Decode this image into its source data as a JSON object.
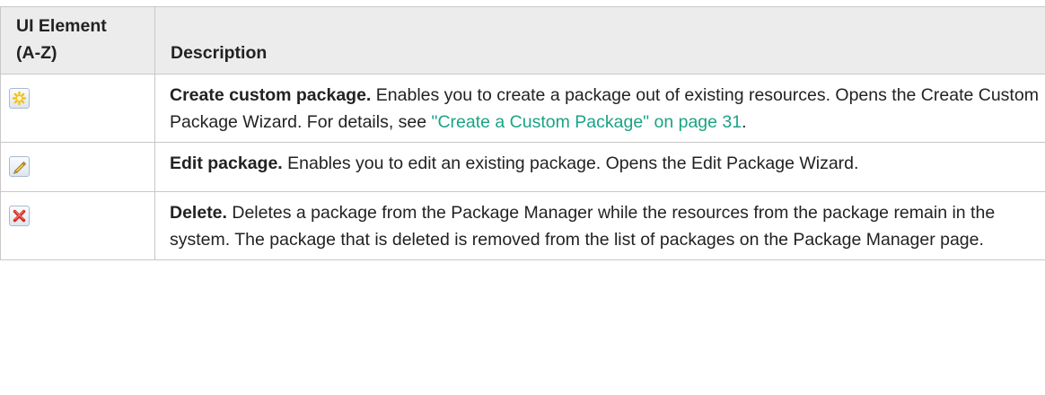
{
  "table": {
    "headers": {
      "element_line1": "UI Element",
      "element_line2": "(A-Z)",
      "description": "Description"
    },
    "rows": [
      {
        "icon": "new-star-icon",
        "term": "Create custom package.",
        "text": " Enables you to create a package out of existing resources. Opens the Create Custom Package Wizard. For details, see ",
        "link": "\"Create a Custom Package\" on page 31",
        "after": "."
      },
      {
        "icon": "pencil-edit-icon",
        "term": "Edit package.",
        "text": " Enables you to edit an existing package. Opens the Edit Package Wizard."
      },
      {
        "icon": "red-x-delete-icon",
        "term": "Delete.",
        "text": " Deletes a package from the Package Manager while the resources from the package remain in the system. The package that is deleted is removed from the list of packages on the Package Manager page."
      }
    ]
  },
  "colors": {
    "header_bg": "#ececec",
    "border": "#c8c8c8",
    "link": "#1aa385",
    "star": "#f5c116",
    "delete": "#d9261c"
  }
}
